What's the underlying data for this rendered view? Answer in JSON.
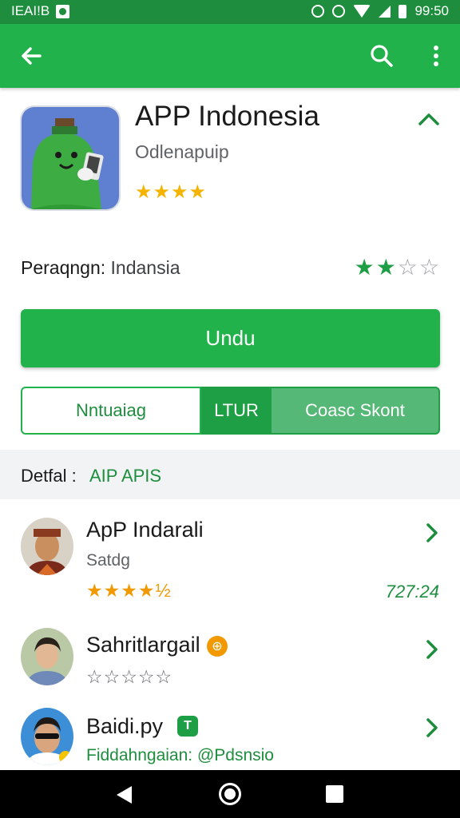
{
  "status_bar": {
    "left_text": "IEAI!B",
    "time": "99:50"
  },
  "app": {
    "title": "APP Indonesia",
    "developer": "Odlenapuip",
    "rating_stars": "★★★★",
    "rating_value": 4
  },
  "publisher": {
    "label": "Peraqngn:",
    "value": "Indansia",
    "stars_on": "★★",
    "stars_off": "☆☆",
    "rating_value": 2
  },
  "install_button": {
    "label": "Undu"
  },
  "tabs": [
    {
      "label": "Nntuaiag"
    },
    {
      "label": "LTUR"
    },
    {
      "label": "Coasc Skont"
    }
  ],
  "detail": {
    "label": "Detfal :",
    "value": "AIP APIS"
  },
  "list": [
    {
      "title": "ApP Indarali",
      "subtitle": "Satdg",
      "stars": "★★★★½",
      "count": "727:24"
    },
    {
      "title": "Sahritlargail",
      "subtitle": "",
      "stars": "☆☆☆☆☆",
      "count": ""
    },
    {
      "title": "Baidi.py",
      "subtitle": "Fiddahngaian: @Pdsnsio",
      "stars": "",
      "count": ""
    }
  ],
  "colors": {
    "primary": "#22b24c",
    "status_bar": "#1e8e3e",
    "accent_star": "#f5b400"
  }
}
